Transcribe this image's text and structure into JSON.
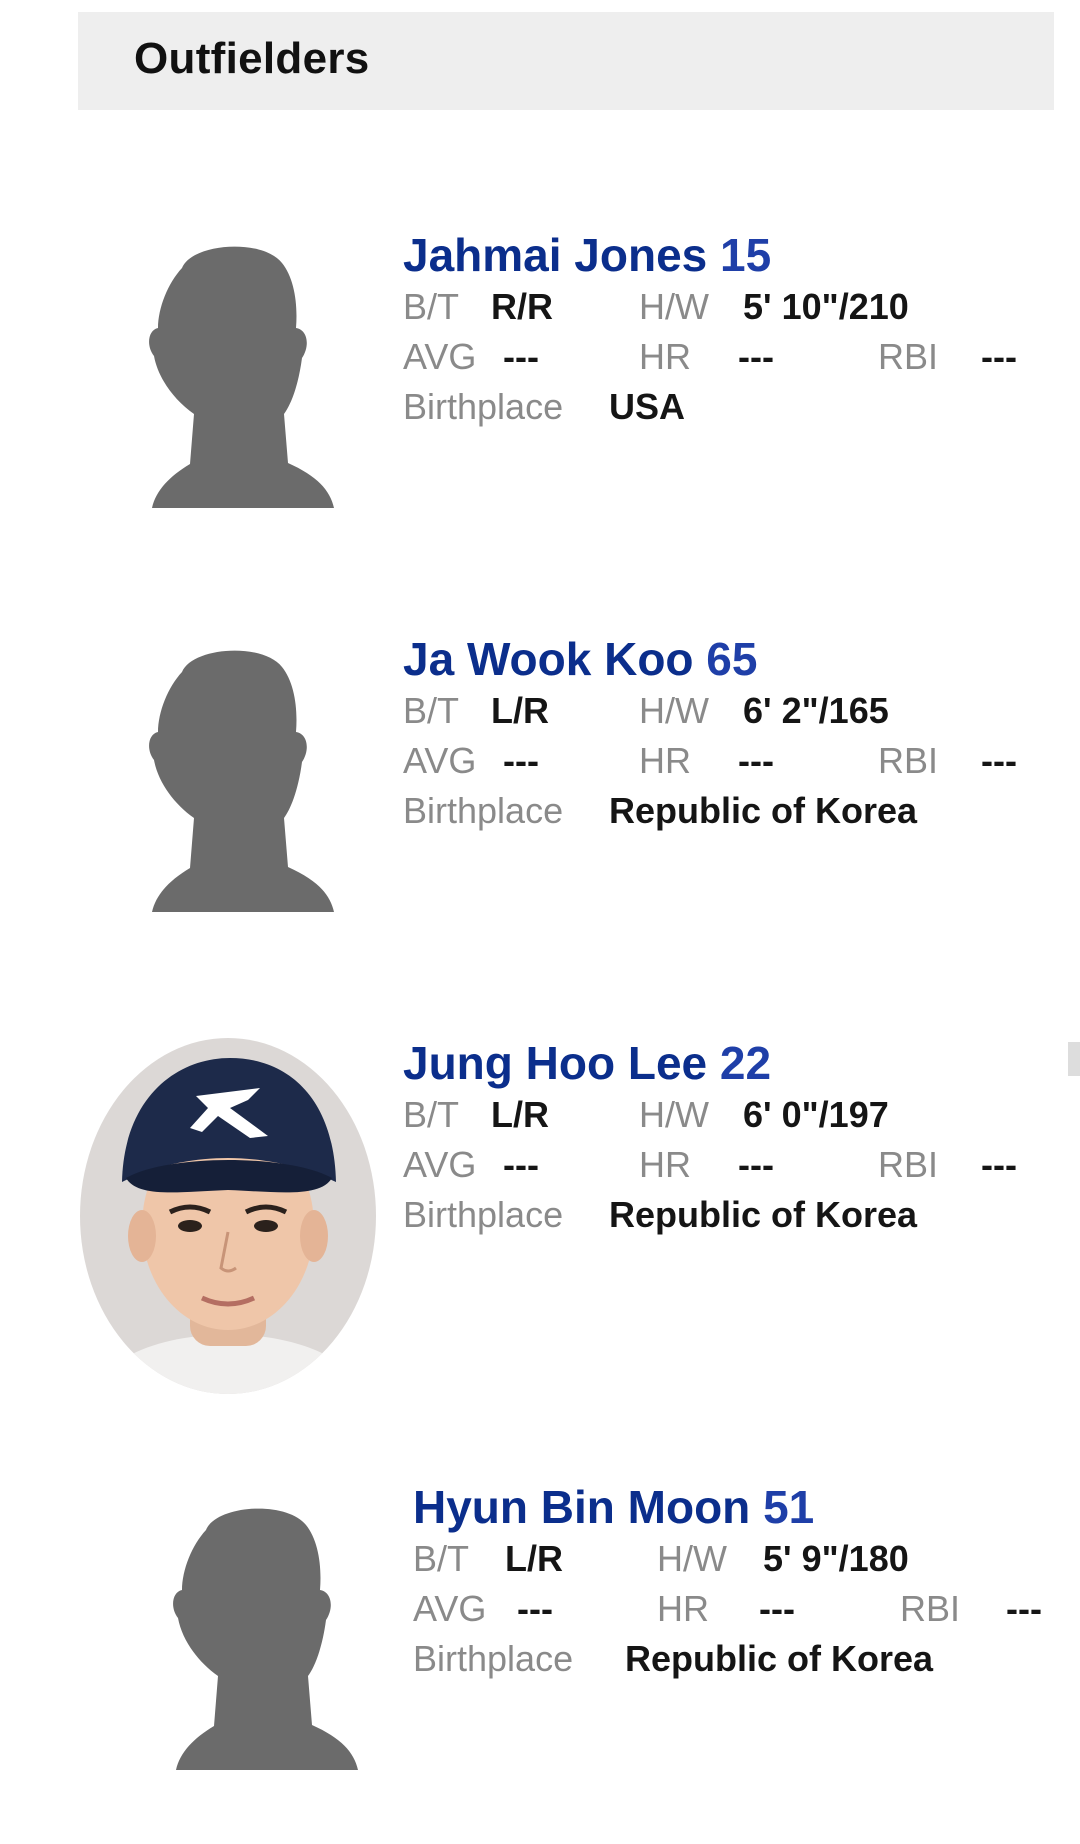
{
  "section": {
    "title": "Outfielders"
  },
  "labels": {
    "bt": "B/T",
    "hw": "H/W",
    "avg": "AVG",
    "hr": "HR",
    "rbi": "RBI",
    "birthplace": "Birthplace"
  },
  "players": [
    {
      "name": "Jahmai Jones",
      "number": "15",
      "bt": "R/R",
      "hw": "5' 10\"/210",
      "avg": "---",
      "hr": "---",
      "rbi": "---",
      "birthplace": "USA",
      "photo": "silhouette"
    },
    {
      "name": "Ja Wook Koo",
      "number": "65",
      "bt": "L/R",
      "hw": "6' 2\"/165",
      "avg": "---",
      "hr": "---",
      "rbi": "---",
      "birthplace": "Republic of Korea",
      "photo": "silhouette"
    },
    {
      "name": "Jung Hoo Lee",
      "number": "22",
      "bt": "L/R",
      "hw": "6' 0\"/197",
      "avg": "---",
      "hr": "---",
      "rbi": "---",
      "birthplace": "Republic of Korea",
      "photo": "headshot"
    },
    {
      "name": "Hyun Bin Moon",
      "number": "51",
      "bt": "L/R",
      "hw": "5' 9\"/180",
      "avg": "---",
      "hr": "---",
      "rbi": "---",
      "birthplace": "Republic of Korea",
      "photo": "silhouette"
    }
  ],
  "colors": {
    "name": "#0b2e8c",
    "label": "#8a8a8a",
    "value": "#151515",
    "header_bg": "#eeeeee",
    "silhouette": "#6b6b6b"
  }
}
